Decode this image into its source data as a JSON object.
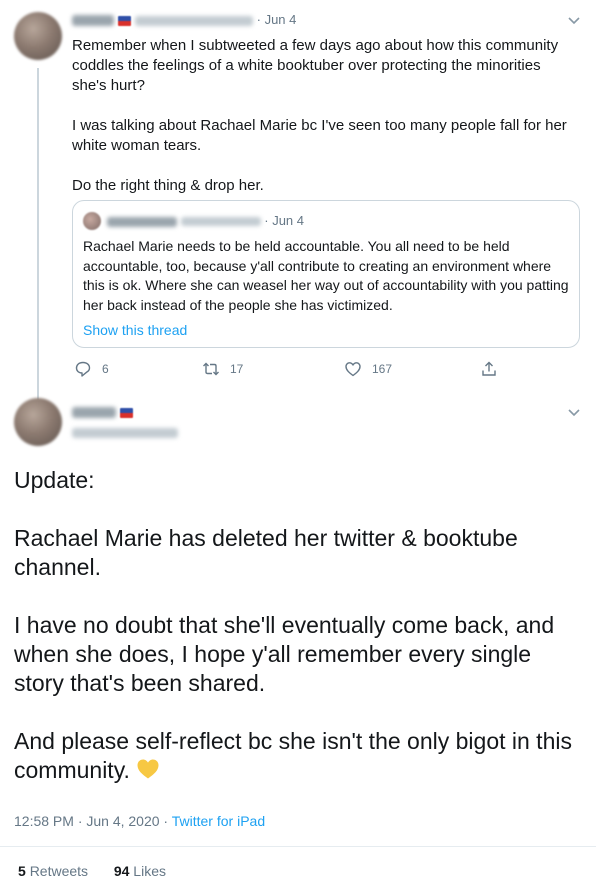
{
  "tweet1": {
    "date": "Jun 4",
    "paragraphs": [
      "Remember when I subtweeted a few days ago about how this community coddles the feelings of a white booktuber over protecting the minorities she's hurt?",
      "I was talking about Rachael Marie bc I've seen too many people fall for her white woman tears.",
      "Do the right thing & drop her."
    ],
    "quote": {
      "date": "Jun 4",
      "text": "Rachael Marie needs to be held accountable. You all need to be held accountable, too, because y'all contribute to creating an environment where this is ok. Where she can weasel her way out of accountability with you patting her back instead of the people she has victimized.",
      "show_thread": "Show this thread"
    },
    "actions": {
      "replies": "6",
      "retweets": "17",
      "likes": "167"
    }
  },
  "tweet2": {
    "text": "Update:\n\nRachael Marie has deleted her twitter & booktube channel.\n\nI have no doubt that she'll eventually come back, and when she does, I hope y'all remember every single story that's been shared.\n\nAnd please self-reflect bc she isn't the only bigot in this community.",
    "time": "12:58 PM · Jun 4, 2020 · ",
    "source": "Twitter for iPad",
    "retweets_count": "5",
    "retweets_label": "Retweets",
    "likes_count": "94",
    "likes_label": "Likes"
  },
  "colors": {
    "accent": "#1da1f2",
    "secondary_text": "#657786",
    "border": "#ccd6dd",
    "emoji_heart": "#f7c843"
  }
}
